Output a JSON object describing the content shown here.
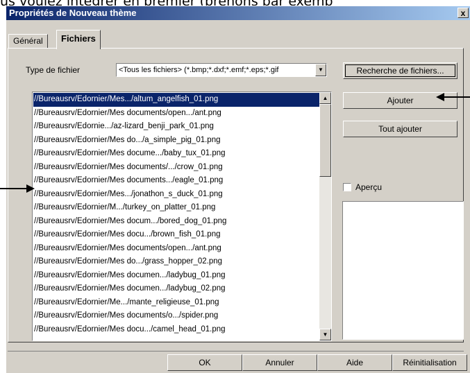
{
  "background_text": "us voulez intégrer en premier (prenons par exemp",
  "dialog": {
    "title": "Propriétés de Nouveau thème",
    "close_label": "x"
  },
  "tabs": [
    {
      "label": "Général",
      "active": false
    },
    {
      "label": "Fichiers",
      "active": true
    }
  ],
  "file_type": {
    "label": "Type de fichier",
    "selected": "<Tous les fichiers> (*.bmp;*.dxf;*.emf;*.eps;*.gif"
  },
  "buttons": {
    "search": "Recherche de fichiers...",
    "add": "Ajouter",
    "add_all": "Tout ajouter",
    "ok": "OK",
    "cancel": "Annuler",
    "help": "Aide",
    "reset": "Réinitialisation"
  },
  "preview_label": "Aperçu",
  "files": [
    "//Bureausrv/Edornier/Mes.../altum_angelfish_01.png",
    "//Bureausrv/Edornier/Mes documents/open.../ant.png",
    "//Bureausrv/Edornie.../az-lizard_benji_park_01.png",
    "//Bureausrv/Edornier/Mes do.../a_simple_pig_01.png",
    "//Bureausrv/Edornier/Mes docume.../baby_tux_01.png",
    "//Bureausrv/Edornier/Mes documents/.../crow_01.png",
    "//Bureausrv/Edornier/Mes documents.../eagle_01.png",
    "//Bureausrv/Edornier/Mes.../jonathon_s_duck_01.png",
    "//Bureausrv/Edornier/M.../turkey_on_platter_01.png",
    "//Bureausrv/Edornier/Mes docum.../bored_dog_01.png",
    "//Bureausrv/Edornier/Mes docu.../brown_fish_01.png",
    "//Bureausrv/Edornier/Mes documents/open.../ant.png",
    "//Bureausrv/Edornier/Mes do.../grass_hopper_02.png",
    "//Bureausrv/Edornier/Mes documen.../ladybug_01.png",
    "//Bureausrv/Edornier/Mes documen.../ladybug_02.png",
    "//Bureausrv/Edornier/Me.../mante_religieuse_01.png",
    "//Bureausrv/Edornier/Mes documents/o.../spider.png",
    "//Bureausrv/Edornier/Mes docu.../camel_head_01.png"
  ],
  "selected_index": 0,
  "colors": {
    "dialog_bg": "#d4d0c8",
    "selection": "#0a246a",
    "title_start": "#0a246a",
    "title_end": "#a6caf0"
  }
}
